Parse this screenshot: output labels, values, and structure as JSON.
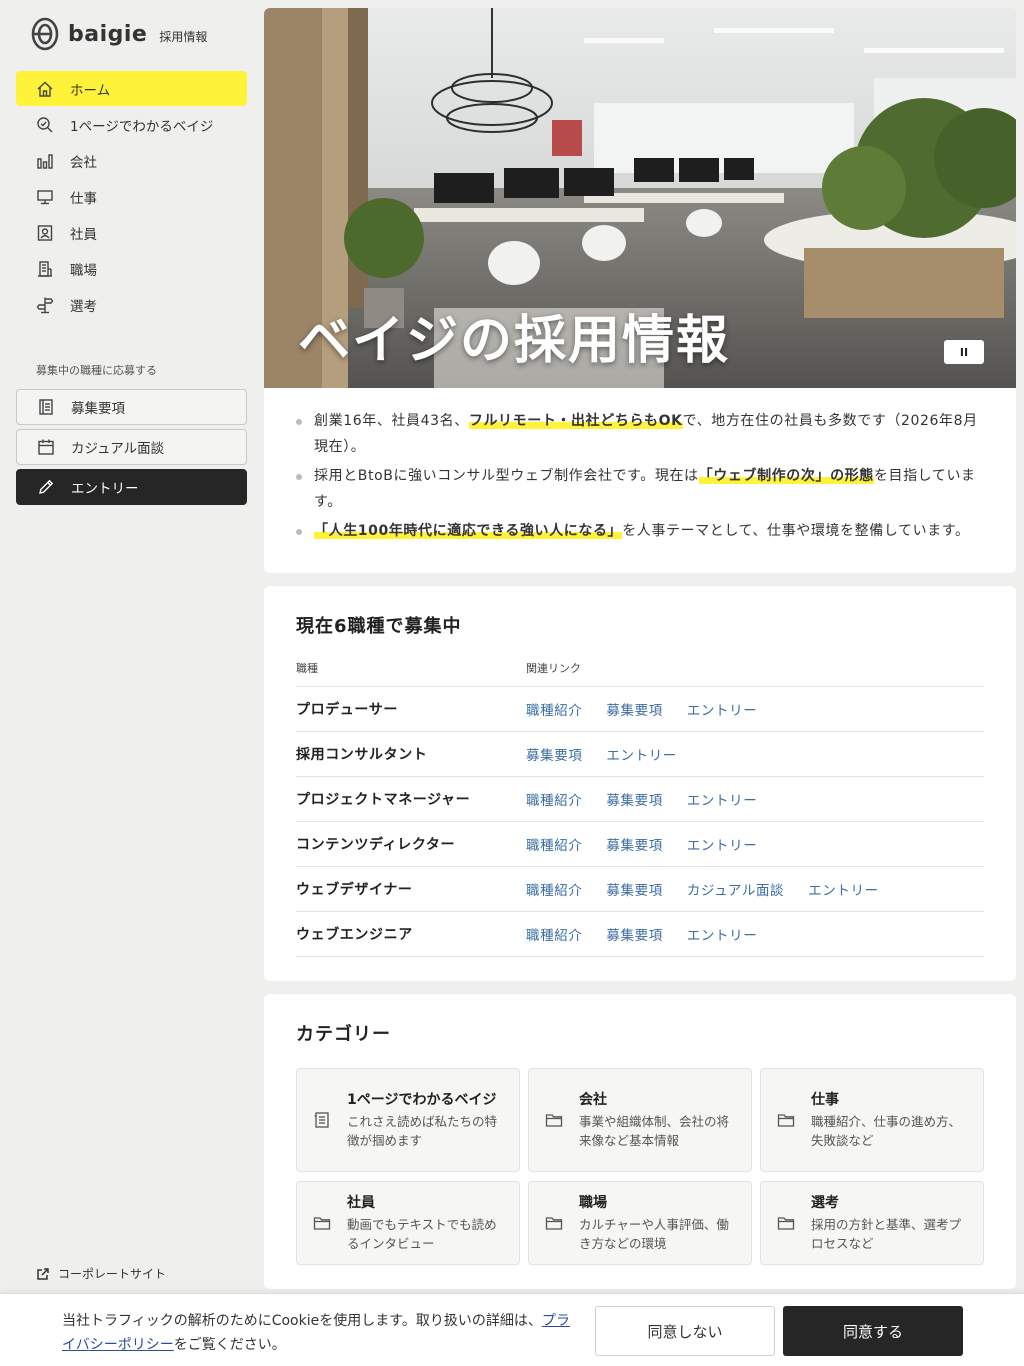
{
  "brand": {
    "name": "baigie",
    "sub": "採用情報",
    "logo_icon": "baigie-logo-icon"
  },
  "sidebar": {
    "items": [
      {
        "label": "ホーム",
        "icon": "home-icon",
        "active": true
      },
      {
        "label": "1ページでわかるベイジ",
        "icon": "search-icon"
      },
      {
        "label": "会社",
        "icon": "bar-chart-icon"
      },
      {
        "label": "仕事",
        "icon": "monitor-icon"
      },
      {
        "label": "社員",
        "icon": "person-badge-icon"
      },
      {
        "label": "職場",
        "icon": "building-icon"
      },
      {
        "label": "選考",
        "icon": "signpost-icon"
      }
    ],
    "apply_heading": "募集中の職種に応募する",
    "apply": [
      {
        "label": "募集要項",
        "icon": "document-icon"
      },
      {
        "label": "カジュアル面談",
        "icon": "calendar-icon"
      },
      {
        "label": "エントリー",
        "icon": "pencil-icon"
      }
    ],
    "corporate_link": "コーポレートサイト"
  },
  "hero": {
    "title": "ベイジの採用情報",
    "pause_label": "II"
  },
  "intro": [
    {
      "pre": "創業16年、社員43名、",
      "hl": "フルリモート・出社どちらもOK",
      "post": "で、地方在住の社員も多数です（2026年8月現在）。"
    },
    {
      "pre": "採用とBtoBに強いコンサル型ウェブ制作会社です。現在は",
      "hl": "「ウェブ制作の次」の形態",
      "post": "を目指しています。"
    },
    {
      "pre": "",
      "hl": "「人生100年時代に適応できる強い人になる」",
      "post": "を人事テーマとして、仕事や環境を整備しています。"
    }
  ],
  "jobs": {
    "title": "現在6職種で募集中",
    "col_role": "職種",
    "col_links": "関連リンク",
    "rows": [
      {
        "role": "プロデューサー",
        "links": [
          "職種紹介",
          "募集要項",
          "エントリー"
        ]
      },
      {
        "role": "採用コンサルタント",
        "links": [
          "募集要項",
          "エントリー"
        ]
      },
      {
        "role": "プロジェクトマネージャー",
        "links": [
          "職種紹介",
          "募集要項",
          "エントリー"
        ]
      },
      {
        "role": "コンテンツディレクター",
        "links": [
          "職種紹介",
          "募集要項",
          "エントリー"
        ]
      },
      {
        "role": "ウェブデザイナー",
        "links": [
          "職種紹介",
          "募集要項",
          "カジュアル面談",
          "エントリー"
        ]
      },
      {
        "role": "ウェブエンジニア",
        "links": [
          "職種紹介",
          "募集要項",
          "エントリー"
        ]
      }
    ]
  },
  "categories": {
    "title": "カテゴリー",
    "items": [
      {
        "title": "1ページでわかるベイジ",
        "desc": "これさえ読めば私たちの特徴が掴めます",
        "icon": "document-icon"
      },
      {
        "title": "会社",
        "desc": "事業や組織体制、会社の将来像など基本情報",
        "icon": "folder-icon"
      },
      {
        "title": "仕事",
        "desc": "職種紹介、仕事の進め方、失敗談など",
        "icon": "folder-icon"
      },
      {
        "title": "社員",
        "desc": "動画でもテキストでも読めるインタビュー",
        "icon": "folder-icon"
      },
      {
        "title": "職場",
        "desc": "カルチャーや人事評価、働き方などの環境",
        "icon": "folder-icon"
      },
      {
        "title": "選考",
        "desc": "採用の方針と基準、選考プロセスなど",
        "icon": "folder-icon"
      }
    ]
  },
  "cookie": {
    "text_pre": "当社トラフィックの解析のためにCookieを使用します。取り扱いの詳細は、",
    "link": "プライバシーポリシー",
    "text_post": "をご覧ください。",
    "decline": "同意しない",
    "accept": "同意する"
  }
}
